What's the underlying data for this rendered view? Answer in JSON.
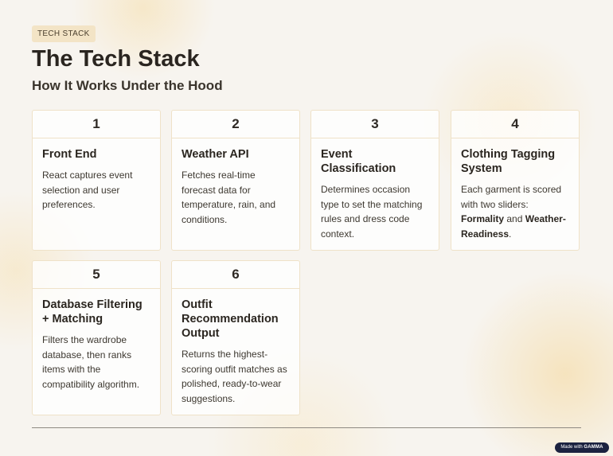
{
  "header": {
    "tag": "TECH STACK",
    "title": "The Tech Stack",
    "subtitle": "How It Works Under the Hood"
  },
  "cards": [
    {
      "number": "1",
      "title": "Front End",
      "description": "React captures event selection and user preferences."
    },
    {
      "number": "2",
      "title": "Weather API",
      "description": "Fetches real-time forecast data for temperature, rain, and conditions."
    },
    {
      "number": "3",
      "title": "Event Classification",
      "description": "Determines occasion type to set the matching rules and dress code context."
    },
    {
      "number": "4",
      "title": "Clothing Tagging System",
      "description_prefix": "Each garment is scored with two sliders: ",
      "description_bold1": "Formality",
      "description_mid": " and ",
      "description_bold2": "Weather-Readiness",
      "description_suffix": "."
    },
    {
      "number": "5",
      "title": "Database Filtering + Matching",
      "description": "Filters the wardrobe database, then ranks items with the compatibility algorithm."
    },
    {
      "number": "6",
      "title": "Outfit Recommendation Output",
      "description": "Returns the highest-scoring outfit matches as polished, ready-to-wear suggestions."
    }
  ],
  "footer": {
    "badge_prefix": "Made with",
    "badge_brand": "GAMMA"
  }
}
